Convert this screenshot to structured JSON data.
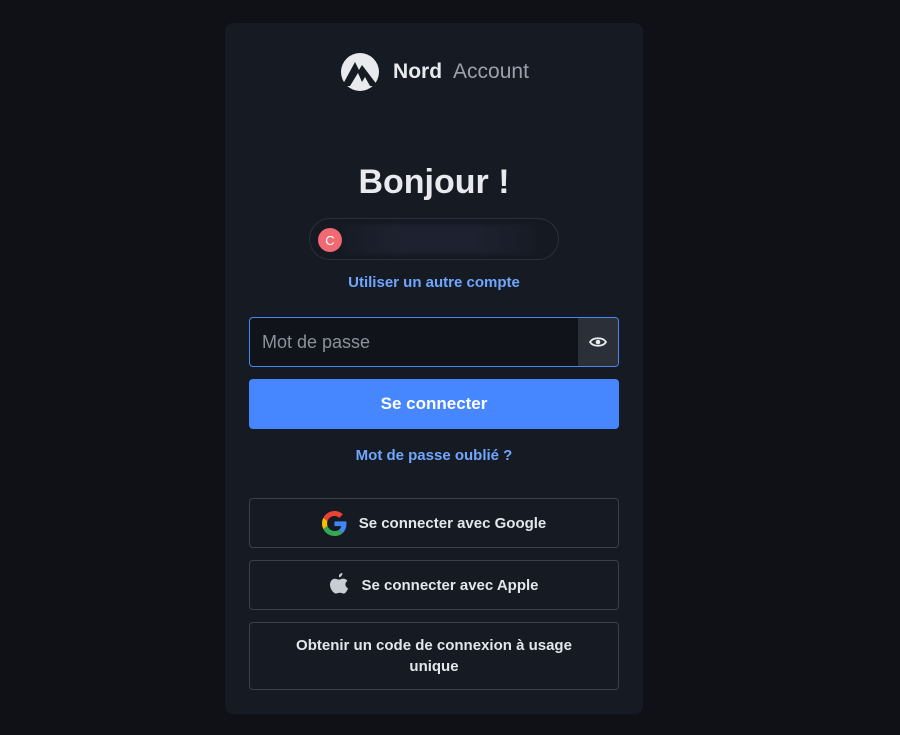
{
  "brand": {
    "name": "Nord",
    "product": "Account"
  },
  "greeting": "Bonjour !",
  "account_chip": {
    "avatar_initial": "C"
  },
  "switch_account_link": "Utiliser un autre compte",
  "password": {
    "placeholder": "Mot de passe",
    "value": ""
  },
  "icons": {
    "logo": "nord-mountain-icon",
    "eye": "eye-icon",
    "google": "google-icon",
    "apple": "apple-icon"
  },
  "login_button": "Se connecter",
  "forgot_link": "Mot de passe oublié ?",
  "google_button": "Se connecter avec Google",
  "apple_button": "Se connecter avec Apple",
  "code_button": "Obtenir un code de connexion à usage unique",
  "colors": {
    "accent": "#4687ff",
    "link": "#6fa6ff",
    "background": "#0f1116",
    "card": "#161a22"
  }
}
